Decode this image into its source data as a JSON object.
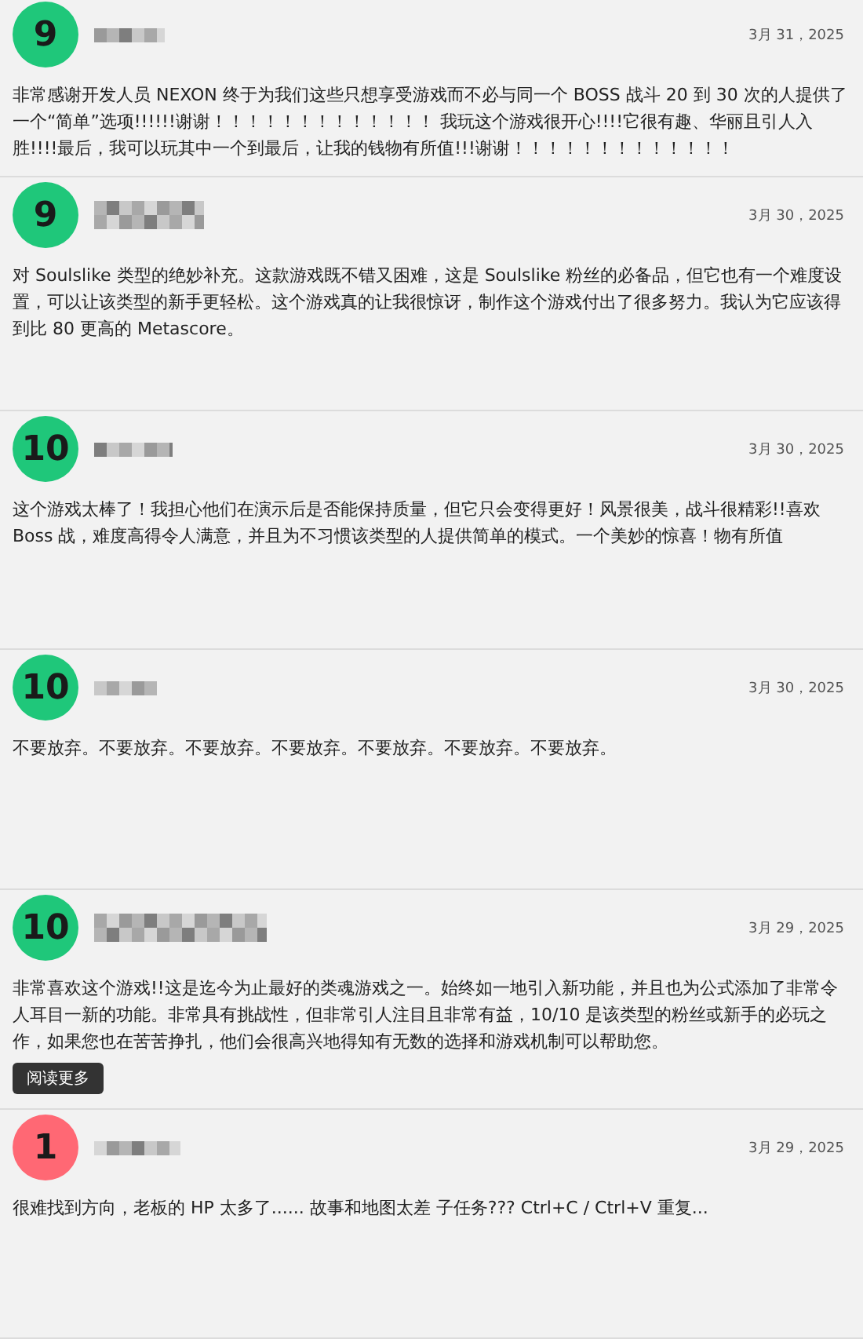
{
  "reviews": [
    {
      "score": "9",
      "color": "#1fc77a",
      "date": "3月 31，2025",
      "text": "非常感谢开发人员 NEXON 终于为我们这些只想享受游戏而不必与同一个 BOSS 战斗 20 到 30 次的人提供了一个“简单”选项!!!!!!谢谢！！！！！！！！！！！！！ 我玩这个游戏很开心!!!!它很有趣、华丽且引人入胜!!!!最后，我可以玩其中一个到最后，让我的钱物有所值!!!谢谢！！！！！！！！！！！！！"
    },
    {
      "score": "9",
      "color": "#1fc77a",
      "date": "3月 30，2025",
      "text": "对 Soulslike 类型的绝妙补充。这款游戏既不错又困难，这是 Soulslike 粉丝的必备品，但它也有一个难度设置，可以让该类型的新手更轻松。这个游戏真的让我很惊讶，制作这个游戏付出了很多努力。我认为它应该得到比 80 更高的 Metascore。"
    },
    {
      "score": "10",
      "color": "#1fc77a",
      "date": "3月 30，2025",
      "text": "这个游戏太棒了！我担心他们在演示后是否能保持质量，但它只会变得更好！风景很美，战斗很精彩!!喜欢 Boss 战，难度高得令人满意，并且为不习惯该类型的人提供简单的模式。一个美妙的惊喜！物有所值"
    },
    {
      "score": "10",
      "color": "#1fc77a",
      "date": "3月 30，2025",
      "text": "不要放弃。不要放弃。不要放弃。不要放弃。不要放弃。不要放弃。不要放弃。"
    },
    {
      "score": "10",
      "color": "#1fc77a",
      "date": "3月 29，2025",
      "text": "非常喜欢这个游戏!!这是迄今为止最好的类魂游戏之一。始终如一地引入新功能，并且也为公式添加了非常令人耳目一新的功能。非常具有挑战性，但非常引人注目且非常有益，10/10 是该类型的粉丝或新手的必玩之作，如果您也在苦苦挣扎，他们会很高兴地得知有无数的选择和游戏机制可以帮助您。",
      "more": "阅读更多"
    },
    {
      "score": "1",
      "color": "#ff6874",
      "date": "3月 29，2025",
      "text": "很难找到方向，老板的 HP 太多了...... 故事和地图太差 子任务??? Ctrl+C / Ctrl+V 重复..."
    }
  ]
}
